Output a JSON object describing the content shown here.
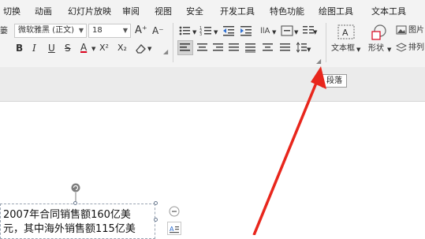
{
  "menubar": {
    "items": [
      {
        "label": "切换"
      },
      {
        "label": "动画"
      },
      {
        "label": "幻灯片放映"
      },
      {
        "label": "审阅"
      },
      {
        "label": "视图"
      },
      {
        "label": "安全"
      },
      {
        "label": "开发工具"
      },
      {
        "label": "特色功能"
      },
      {
        "label": "绘图工具"
      },
      {
        "label": "文本工具"
      }
    ]
  },
  "ribbon": {
    "font_name": "微软雅黑 (正文)",
    "font_size": "18",
    "grow_font_label": "A⁺",
    "shrink_font_label": "A⁻",
    "bold_label": "B",
    "italic_label": "I",
    "underline_label": "U",
    "strike_label": "S",
    "font_color_label": "A",
    "superscript_label": "X²",
    "subscript_label": "X₂",
    "textbox_label": "文本框",
    "shape_label": "形状",
    "picture_label": "图片",
    "arrange_label": "排列",
    "left_cut_label": "篓",
    "accent_red": "#d9001b"
  },
  "tooltip": {
    "text": "段落"
  },
  "document": {
    "line1": "2007年合同销售额160亿美",
    "line2": "元，其中海外销售额115亿美"
  },
  "annotation": {
    "arrow_color": "#e8261c"
  }
}
